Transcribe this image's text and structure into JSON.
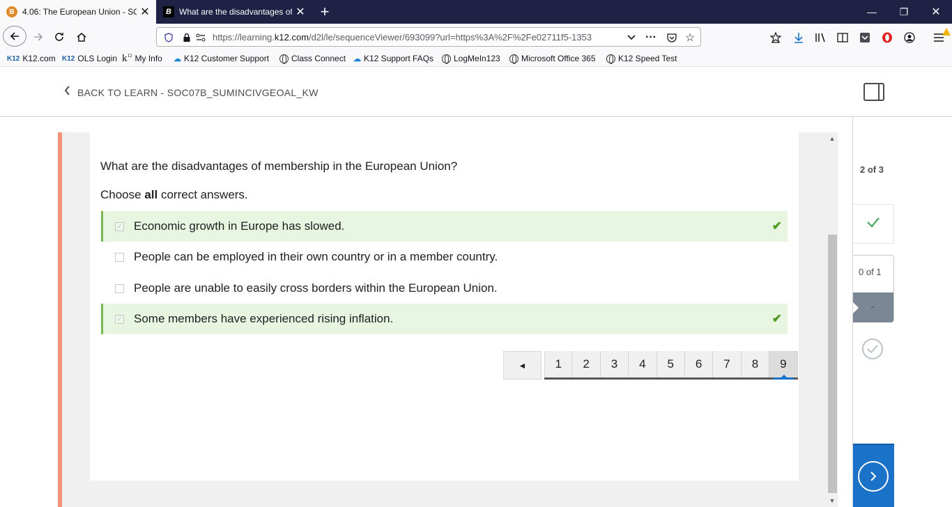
{
  "browser": {
    "tabs": [
      {
        "title": "4.06: The European Union - SOC",
        "favicon": "brightspace-icon",
        "active": true
      },
      {
        "title": "What are the disadvantages of ",
        "favicon": "b-icon",
        "active": false
      }
    ],
    "url": {
      "prefix": "https://learning.",
      "domain": "k12.com",
      "path": "/d2l/le/sequenceViewer/693099?url=https%3A%2F%2Fe02711f5-1353"
    },
    "bookmarks": [
      {
        "label": "K12.com",
        "icon": "k12-icon"
      },
      {
        "label": "OLS Login",
        "icon": "k12-icon"
      },
      {
        "label": "My Info",
        "icon": "k12-logo-icon"
      },
      {
        "label": "K12 Customer Support",
        "icon": "cloud-icon"
      },
      {
        "label": "Class Connect",
        "icon": "globe-icon"
      },
      {
        "label": "K12 Support FAQs",
        "icon": "cloud-icon"
      },
      {
        "label": "LogMeIn123",
        "icon": "globe-icon"
      },
      {
        "label": "Microsoft Office 365",
        "icon": "globe-icon"
      },
      {
        "label": "K12 Speed Test",
        "icon": "globe-icon"
      }
    ]
  },
  "header": {
    "back_label": "BACK TO LEARN - SOC07B_SUMINCIVGEOAL_KW"
  },
  "quiz": {
    "question": "What are the disadvantages of membership in the European Union?",
    "instruction_pre": "Choose ",
    "instruction_bold": "all",
    "instruction_post": " correct answers.",
    "options": [
      {
        "text": "Economic growth in Europe has slowed.",
        "selected": true,
        "correct": true
      },
      {
        "text": "People can be employed in their own country or in a member country.",
        "selected": false,
        "correct": false
      },
      {
        "text": "People are unable to easily cross borders within the European Union.",
        "selected": false,
        "correct": false
      },
      {
        "text": "Some members have experienced rising inflation.",
        "selected": true,
        "correct": true
      }
    ],
    "pagination": {
      "prev": "◄",
      "pages": [
        "1",
        "2",
        "3",
        "4",
        "5",
        "6",
        "7",
        "8",
        "9"
      ],
      "current": "9"
    }
  },
  "sidebar": {
    "progress": "2 of 3",
    "current_step": "0 of 1"
  },
  "colors": {
    "accent": "#1a73c8",
    "correct_bg": "#e8f5e1",
    "correct_border": "#76b852",
    "left_accent": "#f2927a"
  }
}
